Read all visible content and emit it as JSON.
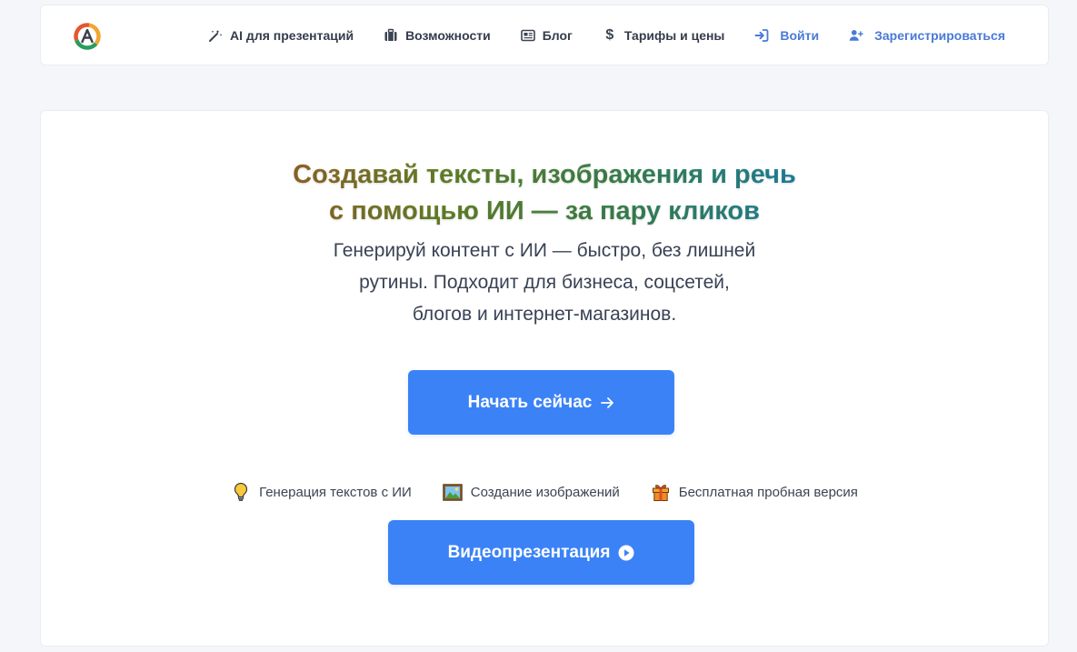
{
  "nav": {
    "items": [
      {
        "label": "AI для презентаций",
        "icon": "magic-wand-icon"
      },
      {
        "label": "Возможности",
        "icon": "briefcase-icon"
      },
      {
        "label": "Блог",
        "icon": "newspaper-icon"
      },
      {
        "label": "Тарифы и цены",
        "icon": "dollar-icon"
      }
    ],
    "login": {
      "label": "Войти",
      "icon": "sign-in-icon"
    },
    "register": {
      "label": "Зарегистрироваться",
      "icon": "user-plus-icon"
    }
  },
  "hero": {
    "headline_line1": "Создавай тексты, изображения и речь",
    "headline_line2": "с помощью ИИ — за пару кликов",
    "subtitle_line1": "Генерируй контент с ИИ — быстро, без лишней",
    "subtitle_line2": "рутины. Подходит для бизнеса, соцсетей,",
    "subtitle_line3": "блогов и интернет-магазинов.",
    "start_button": "Начать сейчас",
    "video_button": "Видеопрезентация"
  },
  "features": [
    {
      "label": "Генерация текстов с ИИ",
      "icon": "lightbulb-icon"
    },
    {
      "label": "Создание изображений",
      "icon": "picture-icon"
    },
    {
      "label": "Бесплатная пробная версия",
      "icon": "gift-icon"
    }
  ],
  "colors": {
    "accent": "#3b82f6",
    "link": "#4a7ad6",
    "page_bg": "#f4f6f9"
  }
}
